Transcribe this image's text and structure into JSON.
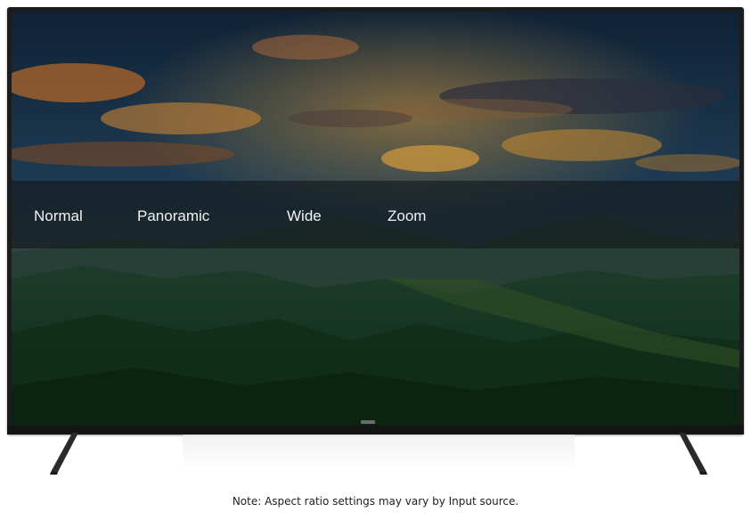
{
  "aspect_menu": {
    "options": [
      {
        "label": "Normal"
      },
      {
        "label": "Panoramic"
      },
      {
        "label": "Wide"
      },
      {
        "label": "Zoom"
      }
    ]
  },
  "footer": {
    "note": "Note: Aspect ratio settings may vary by Input source."
  },
  "colors": {
    "menu_text": "#f2f2f2",
    "tv_frame": "#1c1c1c",
    "note_text": "#222222"
  }
}
